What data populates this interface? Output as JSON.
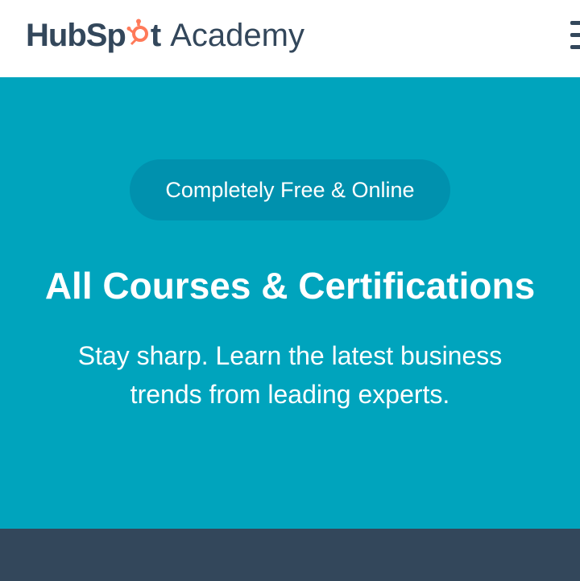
{
  "header": {
    "logo_hub": "HubSp",
    "logo_t": "t",
    "logo_academy": "Academy",
    "menu_icon": "hamburger-menu-icon"
  },
  "hero": {
    "badge": "Completely Free & Online",
    "title": "All Courses & Certifications",
    "subtitle": "Stay sharp. Learn the latest business trends from leading experts."
  },
  "colors": {
    "brand_dark": "#33475b",
    "sprocket_orange": "#ff7a59",
    "hero_bg": "#00a4bd",
    "badge_bg": "#0091ae",
    "footer_bg": "#33475b"
  }
}
